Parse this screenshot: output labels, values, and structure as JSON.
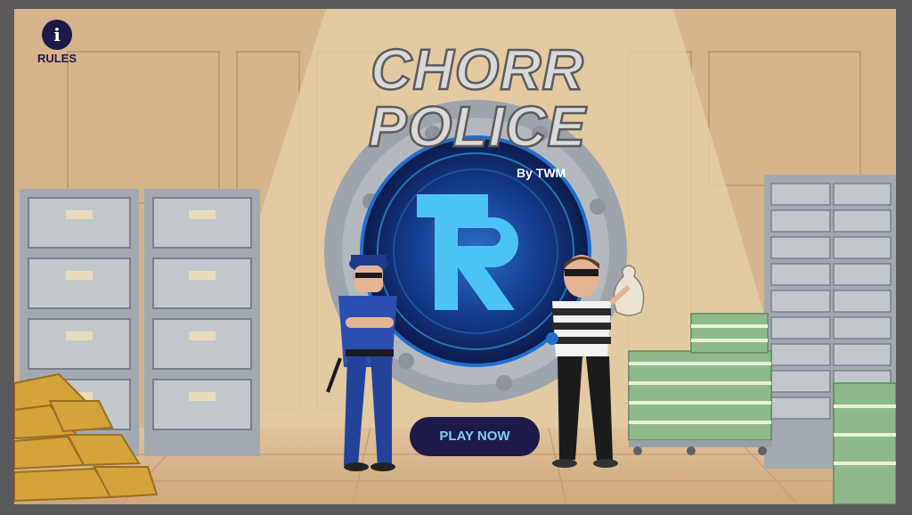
{
  "header": {
    "rules_icon_glyph": "i",
    "rules_label": "RULES"
  },
  "title": {
    "line1": "CHORR",
    "line2": "POLICE",
    "byline": "By TWM"
  },
  "play_button": {
    "label": "PLAY NOW"
  },
  "colors": {
    "navy": "#1d1a4a",
    "play_text": "#7fd1f5",
    "wall": "#d9b890",
    "vault_glow": "#2aa4e8"
  },
  "icons": [
    "info-icon",
    "vault-logo-icon"
  ]
}
